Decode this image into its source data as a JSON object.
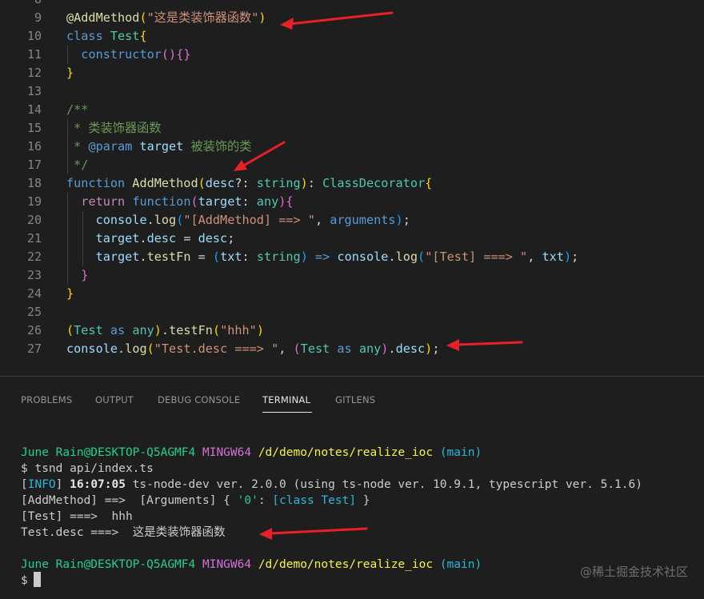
{
  "editor": {
    "lines": [
      {
        "num": "8",
        "tokens": []
      },
      {
        "num": "9",
        "tokens": [
          {
            "t": "@AddMethod",
            "c": "fn"
          },
          {
            "t": "(",
            "c": "br1"
          },
          {
            "t": "\"这是类装饰器函数\"",
            "c": "str"
          },
          {
            "t": ")",
            "c": "br1"
          }
        ]
      },
      {
        "num": "10",
        "tokens": [
          {
            "t": "class ",
            "c": "kw"
          },
          {
            "t": "Test",
            "c": "cls"
          },
          {
            "t": "{",
            "c": "br1"
          }
        ]
      },
      {
        "num": "11",
        "tokens": [
          {
            "t": "  "
          },
          {
            "t": "constructor",
            "c": "kw"
          },
          {
            "t": "()",
            "c": "br2"
          },
          {
            "t": "{}",
            "c": "br2"
          }
        ]
      },
      {
        "num": "12",
        "tokens": [
          {
            "t": "}",
            "c": "br1"
          }
        ]
      },
      {
        "num": "13",
        "tokens": []
      },
      {
        "num": "14",
        "tokens": [
          {
            "t": "/**",
            "c": "cmt"
          }
        ]
      },
      {
        "num": "15",
        "tokens": [
          {
            "t": " * 类装饰器函数",
            "c": "cmt"
          }
        ]
      },
      {
        "num": "16",
        "tokens": [
          {
            "t": " * ",
            "c": "cmt"
          },
          {
            "t": "@param",
            "c": "kw"
          },
          {
            "t": " "
          },
          {
            "t": "target",
            "c": "var"
          },
          {
            "t": " 被装饰的类",
            "c": "cmt"
          }
        ]
      },
      {
        "num": "17",
        "tokens": [
          {
            "t": " */",
            "c": "cmt"
          }
        ]
      },
      {
        "num": "18",
        "tokens": [
          {
            "t": "function ",
            "c": "kw"
          },
          {
            "t": "AddMethod",
            "c": "fn"
          },
          {
            "t": "(",
            "c": "br1"
          },
          {
            "t": "desc",
            "c": "var"
          },
          {
            "t": "?: "
          },
          {
            "t": "string",
            "c": "cls"
          },
          {
            "t": ")",
            "c": "br1"
          },
          {
            "t": ": "
          },
          {
            "t": "ClassDecorator",
            "c": "cls"
          },
          {
            "t": "{",
            "c": "br1"
          }
        ]
      },
      {
        "num": "19",
        "tokens": [
          {
            "t": "  "
          },
          {
            "t": "return ",
            "c": "ctl"
          },
          {
            "t": "function",
            "c": "kw"
          },
          {
            "t": "(",
            "c": "br2"
          },
          {
            "t": "target",
            "c": "var"
          },
          {
            "t": ": "
          },
          {
            "t": "any",
            "c": "cls"
          },
          {
            "t": ")",
            "c": "br2"
          },
          {
            "t": "{",
            "c": "br2"
          }
        ]
      },
      {
        "num": "20",
        "tokens": [
          {
            "t": "    "
          },
          {
            "t": "console",
            "c": "var"
          },
          {
            "t": "."
          },
          {
            "t": "log",
            "c": "fn"
          },
          {
            "t": "(",
            "c": "br3"
          },
          {
            "t": "\"[AddMethod] ==> \"",
            "c": "str"
          },
          {
            "t": ", "
          },
          {
            "t": "arguments",
            "c": "kw"
          },
          {
            "t": ")",
            "c": "br3"
          },
          {
            "t": ";"
          }
        ]
      },
      {
        "num": "21",
        "tokens": [
          {
            "t": "    "
          },
          {
            "t": "target",
            "c": "var"
          },
          {
            "t": "."
          },
          {
            "t": "desc",
            "c": "var"
          },
          {
            "t": " = "
          },
          {
            "t": "desc",
            "c": "var"
          },
          {
            "t": ";"
          }
        ]
      },
      {
        "num": "22",
        "tokens": [
          {
            "t": "    "
          },
          {
            "t": "target",
            "c": "var"
          },
          {
            "t": "."
          },
          {
            "t": "testFn",
            "c": "fn"
          },
          {
            "t": " = "
          },
          {
            "t": "(",
            "c": "br3"
          },
          {
            "t": "txt",
            "c": "var"
          },
          {
            "t": ": "
          },
          {
            "t": "string",
            "c": "cls"
          },
          {
            "t": ")",
            "c": "br3"
          },
          {
            "t": " => ",
            "c": "kw"
          },
          {
            "t": "console",
            "c": "var"
          },
          {
            "t": "."
          },
          {
            "t": "log",
            "c": "fn"
          },
          {
            "t": "(",
            "c": "br3"
          },
          {
            "t": "\"[Test] ===> \"",
            "c": "str"
          },
          {
            "t": ", "
          },
          {
            "t": "txt",
            "c": "var"
          },
          {
            "t": ")",
            "c": "br3"
          },
          {
            "t": ";"
          }
        ]
      },
      {
        "num": "23",
        "tokens": [
          {
            "t": "  "
          },
          {
            "t": "}",
            "c": "br2"
          }
        ]
      },
      {
        "num": "24",
        "tokens": [
          {
            "t": "}",
            "c": "br1"
          }
        ]
      },
      {
        "num": "25",
        "tokens": []
      },
      {
        "num": "26",
        "tokens": [
          {
            "t": "(",
            "c": "br1"
          },
          {
            "t": "Test",
            "c": "cls"
          },
          {
            "t": " as ",
            "c": "kw"
          },
          {
            "t": "any",
            "c": "cls"
          },
          {
            "t": ")",
            "c": "br1"
          },
          {
            "t": "."
          },
          {
            "t": "testFn",
            "c": "fn"
          },
          {
            "t": "(",
            "c": "br1"
          },
          {
            "t": "\"hhh\"",
            "c": "str"
          },
          {
            "t": ")",
            "c": "br1"
          }
        ]
      },
      {
        "num": "27",
        "tokens": [
          {
            "t": "console",
            "c": "var"
          },
          {
            "t": "."
          },
          {
            "t": "log",
            "c": "fn"
          },
          {
            "t": "(",
            "c": "br1"
          },
          {
            "t": "\"Test.desc ===> \"",
            "c": "str"
          },
          {
            "t": ", "
          },
          {
            "t": "(",
            "c": "br2"
          },
          {
            "t": "Test",
            "c": "cls"
          },
          {
            "t": " as ",
            "c": "kw"
          },
          {
            "t": "any",
            "c": "cls"
          },
          {
            "t": ")",
            "c": "br2"
          },
          {
            "t": "."
          },
          {
            "t": "desc",
            "c": "var"
          },
          {
            "t": ")",
            "c": "br1"
          },
          {
            "t": ";"
          }
        ]
      }
    ]
  },
  "panel": {
    "tabs": [
      {
        "label": "PROBLEMS",
        "active": false
      },
      {
        "label": "OUTPUT",
        "active": false
      },
      {
        "label": "DEBUG CONSOLE",
        "active": false
      },
      {
        "label": "TERMINAL",
        "active": true
      },
      {
        "label": "GITLENS",
        "active": false
      }
    ]
  },
  "terminal": {
    "prompt1": {
      "user": "June Rain@DESKTOP-Q5AGMF4",
      "shell": "MINGW64",
      "path": "/d/demo/notes/realize_ioc",
      "branch": "(main)"
    },
    "command": "$ tsnd api/index.ts",
    "info_open": "[",
    "info_tag": "INFO",
    "info_close": "]",
    "info_time": "16:07:05",
    "info_text": "ts-node-dev ver. 2.0.0 (using ts-node ver. 10.9.1, typescript ver. 5.1.6)",
    "addmethod_prefix": "[AddMethod] ==>  [Arguments] { ",
    "addmethod_key": "'0'",
    "addmethod_colon": ": ",
    "addmethod_value": "[class Test]",
    "addmethod_suffix": " }",
    "test_line": "[Test] ===>  hhh",
    "desc_prefix": "Test.desc ===>  ",
    "desc_value": "这是类装饰器函数",
    "prompt2": {
      "user": "June Rain@DESKTOP-Q5AGMF4",
      "shell": "MINGW64",
      "path": "/d/demo/notes/realize_ioc",
      "branch": "(main)"
    },
    "prompt_symbol": "$"
  },
  "watermark": "@稀土掘金技术社区",
  "colors": {
    "arrow": "#e8202a",
    "background": "#1e1e1e"
  }
}
